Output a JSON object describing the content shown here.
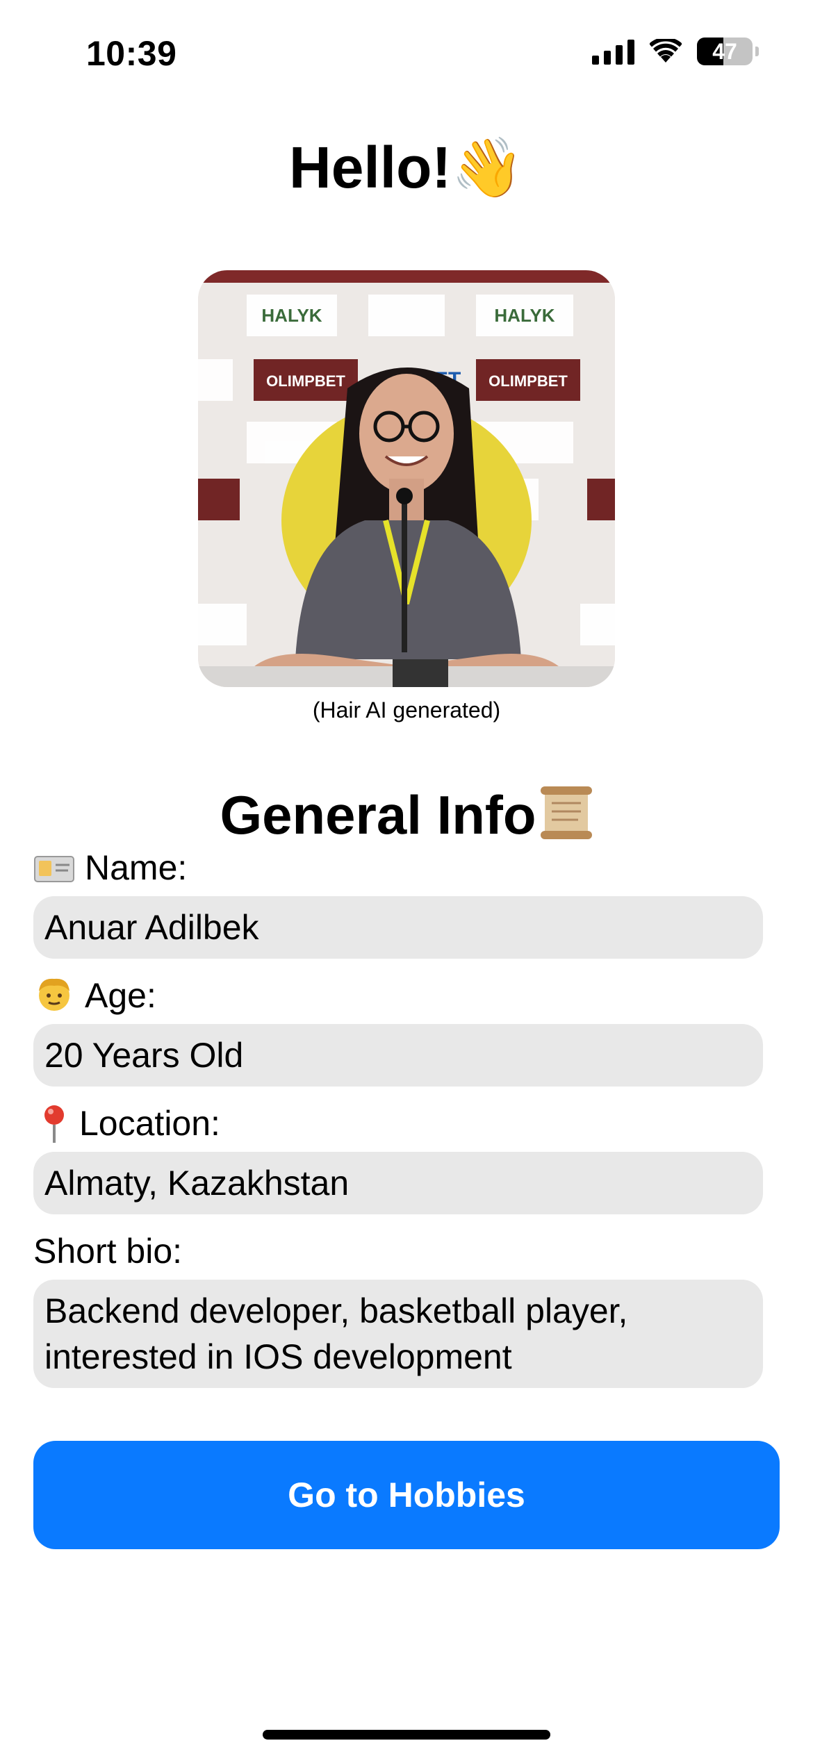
{
  "status_bar": {
    "time": "10:39",
    "battery": "47",
    "battery_level": 0.47
  },
  "header": {
    "title": "Hello!",
    "title_emoji": "👋"
  },
  "photo": {
    "caption": "(Hair AI generated)",
    "backdrop_logos": [
      "HALYK",
      "OLIMPBET",
      "1XBET"
    ]
  },
  "general_info": {
    "title": "General Info",
    "title_icon": "scroll-icon",
    "fields": [
      {
        "label": "Name:",
        "icon": "id-card-icon",
        "value": "Anuar Adilbek"
      },
      {
        "label": "Age:",
        "icon": "person-icon",
        "value": "20 Years Old"
      },
      {
        "label": "Location:",
        "icon": "pin-icon",
        "value": "Almaty, Kazakhstan"
      },
      {
        "label": "Short bio:",
        "icon": "",
        "value": "Backend developer, basketball player, interested in IOS development"
      }
    ]
  },
  "actions": {
    "hobbies_button": "Go to Hobbies"
  },
  "colors": {
    "accent": "#0a7aff",
    "field_background": "#e8e8e8"
  }
}
